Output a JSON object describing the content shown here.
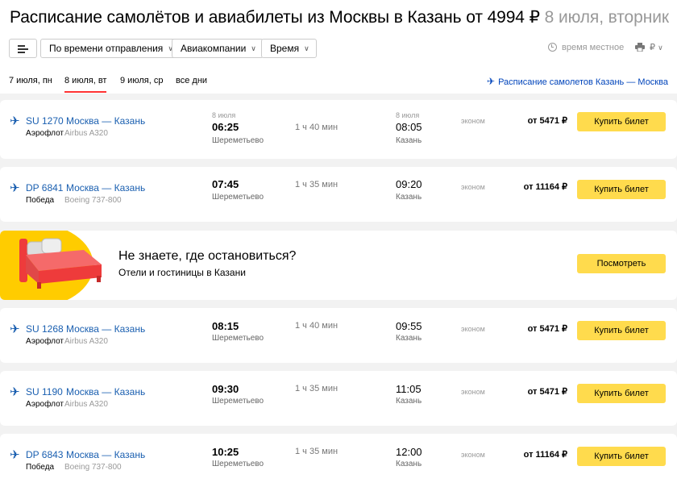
{
  "header": {
    "title_main": "Расписание самолётов и авиабилеты из Москвы в Казань от 4994 ₽",
    "title_date": "8 июля, вторник"
  },
  "filters": {
    "sort": "По времени отправления",
    "airlines": "Авиакомпании",
    "time": "Время",
    "currency": "₽",
    "local_time": "время местное"
  },
  "tabs": [
    {
      "label": "7 июля, пн"
    },
    {
      "label": "8 июля, вт"
    },
    {
      "label": "9 июля, ср"
    },
    {
      "label": "все дни"
    }
  ],
  "reverse_link": "Расписание самолетов Казань — Москва",
  "icons": {
    "plane": "airplane-icon",
    "menu": "menu-icon",
    "clock": "clock-icon",
    "printer": "printer-icon",
    "bed": "bed-icon"
  },
  "colors": {
    "link": "#1a5fb0",
    "accent": "#ffdb4d",
    "active_tab": "#ff3333"
  },
  "flights": [
    {
      "number": "SU 1270",
      "route": "Москва — Казань",
      "airline": "Аэрофлот",
      "aircraft": "Airbus A320",
      "dep_date": "8 июля",
      "dep_time": "06:25",
      "dep_airport": "Шереметьево",
      "duration": "1 ч 40 мин",
      "arr_date": "8 июля",
      "arr_time": "08:05",
      "arr_city": "Казань",
      "class": "эконом",
      "price": "от 5471 ₽",
      "button": "Купить билет"
    },
    {
      "number": "DP 6841",
      "route": "Москва — Казань",
      "airline": "Победа",
      "aircraft": "Boeing 737-800",
      "dep_time": "07:45",
      "dep_airport": "Шереметьево",
      "duration": "1 ч 35 мин",
      "arr_time": "09:20",
      "arr_city": "Казань",
      "class": "эконом",
      "price": "от 11164 ₽",
      "button": "Купить билет"
    },
    {
      "number": "SU 1268",
      "route": "Москва — Казань",
      "airline": "Аэрофлот",
      "aircraft": "Airbus A320",
      "dep_time": "08:15",
      "dep_airport": "Шереметьево",
      "duration": "1 ч 40 мин",
      "arr_time": "09:55",
      "arr_city": "Казань",
      "class": "эконом",
      "price": "от 5471 ₽",
      "button": "Купить билет"
    },
    {
      "number": "SU 1190",
      "route": "Москва — Казань",
      "airline": "Аэрофлот",
      "aircraft": "Airbus A320",
      "dep_time": "09:30",
      "dep_airport": "Шереметьево",
      "duration": "1 ч 35 мин",
      "arr_time": "11:05",
      "arr_city": "Казань",
      "class": "эконом",
      "price": "от 5471 ₽",
      "button": "Купить билет"
    },
    {
      "number": "DP 6843",
      "route": "Москва — Казань",
      "airline": "Победа",
      "aircraft": "Boeing 737-800",
      "dep_time": "10:25",
      "dep_airport": "Шереметьево",
      "duration": "1 ч 35 мин",
      "arr_time": "12:00",
      "arr_city": "Казань",
      "class": "эконом",
      "price": "от 11164 ₽",
      "button": "Купить билет"
    }
  ],
  "hotel_ad": {
    "title": "Не знаете, где остановиться?",
    "subtitle": "Отели и гостиницы в Казани",
    "button": "Посмотреть"
  }
}
